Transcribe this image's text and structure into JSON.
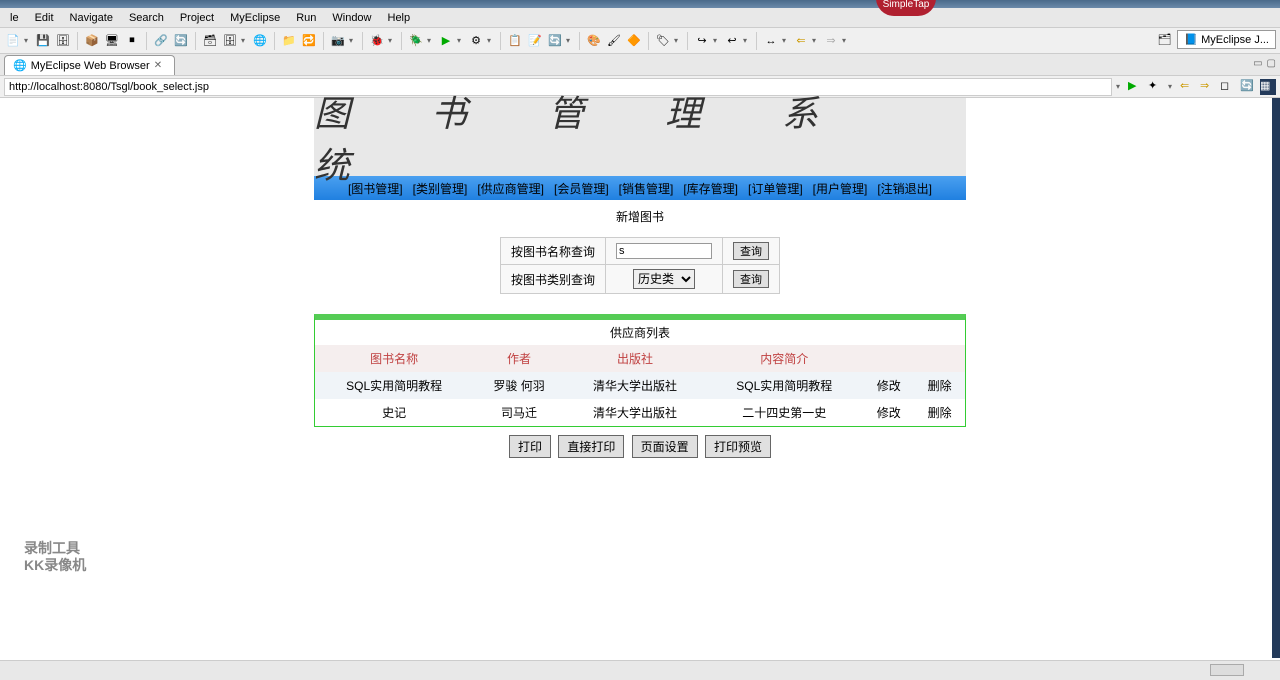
{
  "titlebar": {
    "badge": "SimpleTap"
  },
  "menubar": [
    "le",
    "Edit",
    "Navigate",
    "Search",
    "Project",
    "MyEclipse",
    "Run",
    "Window",
    "Help"
  ],
  "perspective": {
    "label": "MyEclipse J..."
  },
  "tab": {
    "title": "MyEclipse Web Browser"
  },
  "url": "http://localhost:8080/Tsgl/book_select.jsp",
  "banner": "图 书 管 理 系 统",
  "nav": [
    "[图书管理]",
    "[类别管理]",
    "[供应商管理]",
    "[会员管理]",
    "[销售管理]",
    "[库存管理]",
    "[订单管理]",
    "[用户管理]",
    "[注销退出]"
  ],
  "subnav": "新增图书",
  "search": {
    "byNameLabel": "按图书名称查询",
    "nameValue": "s",
    "byCategoryLabel": "按图书类别查询",
    "categoryValue": "历史类",
    "queryBtn": "查询"
  },
  "list": {
    "title": "供应商列表",
    "headers": [
      "图书名称",
      "作者",
      "出版社",
      "内容简介",
      "",
      ""
    ],
    "rows": [
      {
        "name": "SQL实用简明教程",
        "author": "罗骏 何羽",
        "publisher": "清华大学出版社",
        "summary": "SQL实用简明教程",
        "edit": "修改",
        "del": "删除"
      },
      {
        "name": "史记",
        "author": "司马迁",
        "publisher": "清华大学出版社",
        "summary": "二十四史第一史",
        "edit": "修改",
        "del": "删除"
      }
    ]
  },
  "footerBtns": [
    "打印",
    "直接打印",
    "页面设置",
    "打印预览"
  ],
  "watermark": {
    "line1": "录制工具",
    "line2": "KK录像机"
  },
  "colors": {
    "navGradTop": "#4aa0f0",
    "navGradBot": "#2080e0",
    "greenBorder": "#5c5",
    "headerText": "#c04040"
  }
}
